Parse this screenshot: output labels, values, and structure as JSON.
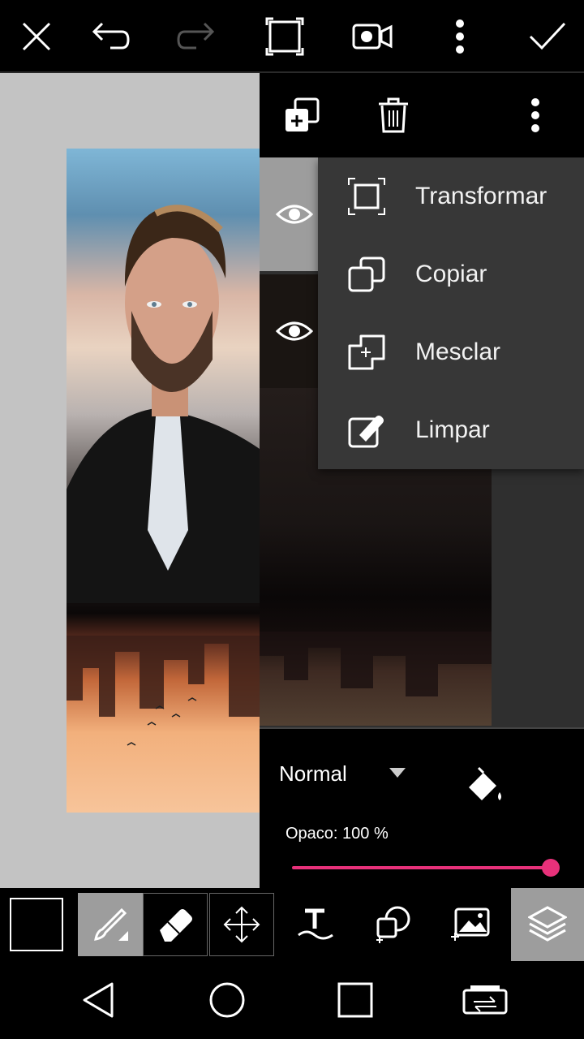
{
  "topbar": {
    "icons": [
      "close-icon",
      "undo-icon",
      "redo-icon",
      "crop-icon",
      "video-icon",
      "more-icon",
      "check-icon"
    ]
  },
  "layers_toolbar": {
    "icons": [
      "add-layer-icon",
      "trash-icon",
      "more-icon"
    ]
  },
  "layer_menu": {
    "items": [
      {
        "label": "Transformar",
        "icon": "transform-icon"
      },
      {
        "label": "Copiar",
        "icon": "copy-icon"
      },
      {
        "label": "Mesclar",
        "icon": "merge-icon"
      },
      {
        "label": "Limpar",
        "icon": "clear-icon"
      }
    ]
  },
  "blend": {
    "mode": "Normal",
    "opacity_label": "Opaco: 100 %",
    "opacity_value": 1.0
  },
  "colors": {
    "accent": "#e8317a",
    "panel": "#2f2f2f",
    "menu": "#373737",
    "canvas_bg": "#c3c3c3"
  },
  "bottom_tools": [
    "color-swatch",
    "brush-icon",
    "eraser-icon",
    "move-icon",
    "text-icon",
    "shape-icon",
    "add-image-icon",
    "layers-icon"
  ],
  "navbar": [
    "back-icon",
    "home-icon",
    "recents-icon",
    "switch-icon"
  ]
}
